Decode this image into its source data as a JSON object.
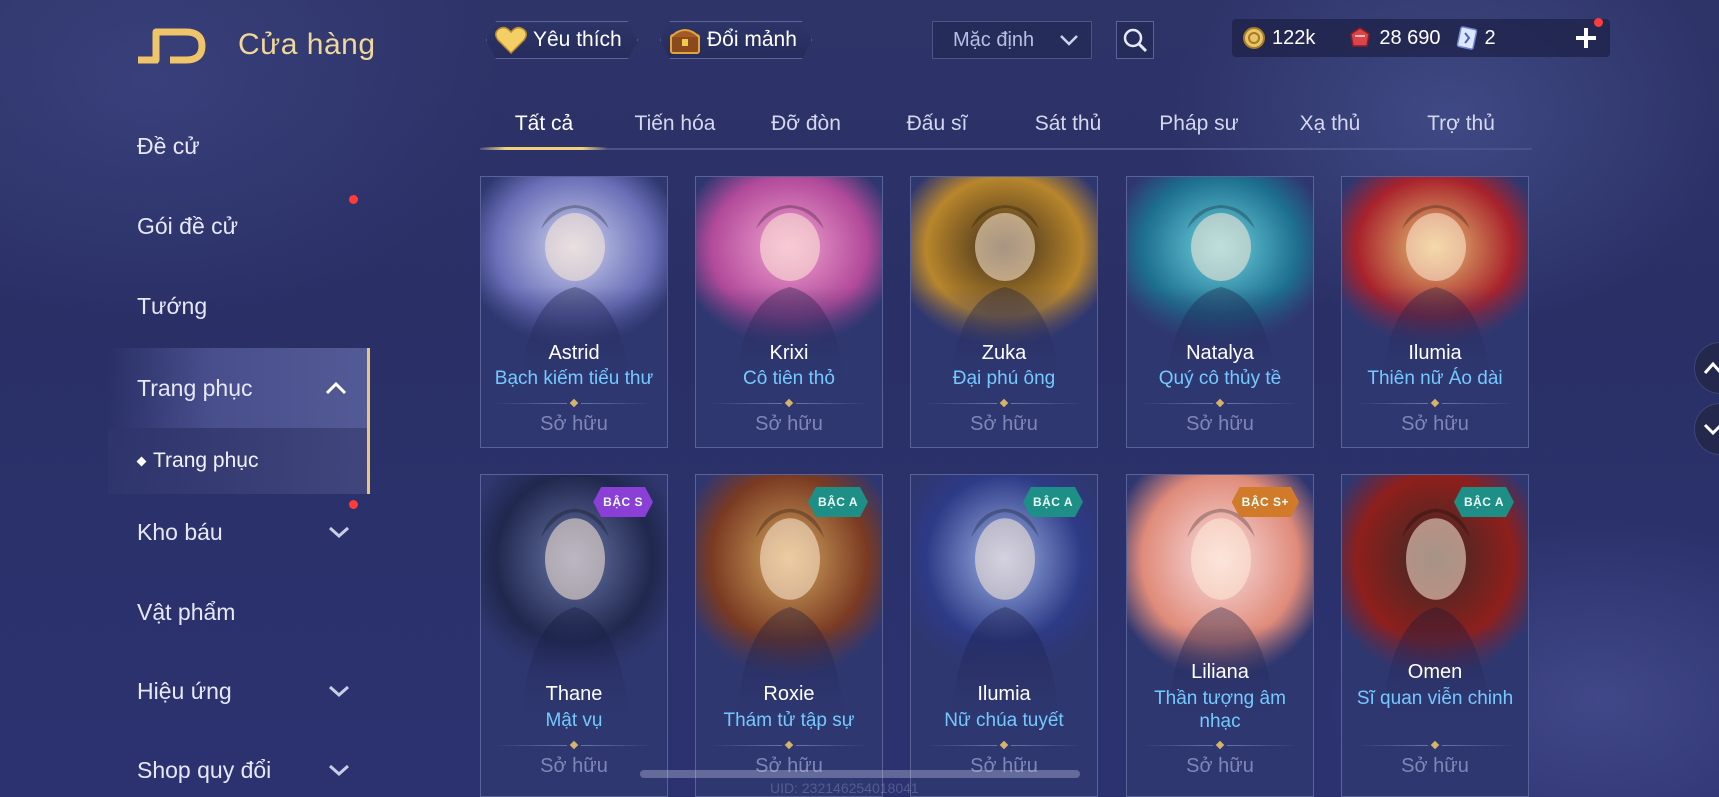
{
  "header": {
    "title": "Cửa hàng",
    "favorite_label": "Yêu thích",
    "fragment_label": "Đổi mảnh",
    "sort_selected": "Mặc định"
  },
  "currency": {
    "gold": "122k",
    "vouchers": "28 690",
    "tickets": "2"
  },
  "sidebar": {
    "items": [
      {
        "label": "Đề cử"
      },
      {
        "label": "Gói đề cử"
      },
      {
        "label": "Tướng"
      },
      {
        "label": "Trang phục"
      },
      {
        "label": "Kho báu"
      },
      {
        "label": "Vật phẩm"
      },
      {
        "label": "Hiệu ứng"
      },
      {
        "label": "Shop quy đổi"
      }
    ],
    "sub_item": "Trang phục"
  },
  "tabs": [
    {
      "label": "Tất cả"
    },
    {
      "label": "Tiến hóa"
    },
    {
      "label": "Đỡ đòn"
    },
    {
      "label": "Đấu sĩ"
    },
    {
      "label": "Sát thủ"
    },
    {
      "label": "Pháp sư"
    },
    {
      "label": "Xạ thủ"
    },
    {
      "label": "Trợ thủ"
    }
  ],
  "cards": [
    {
      "hero": "Astrid",
      "skin": "Bạch kiếm tiểu thư",
      "status": "Sở hữu",
      "colors": [
        "#6a6fb8",
        "#cfd3ee"
      ]
    },
    {
      "hero": "Krixi",
      "skin": "Cô tiên thỏ",
      "status": "Sở hữu",
      "colors": [
        "#b24a9a",
        "#f2a3d2"
      ]
    },
    {
      "hero": "Zuka",
      "skin": "Đại phú ông",
      "status": "Sở hữu",
      "colors": [
        "#b8862c",
        "#3d2c1a"
      ]
    },
    {
      "hero": "Natalya",
      "skin": "Quý cô thủy tề",
      "status": "Sở hữu",
      "colors": [
        "#1d6f8f",
        "#6fd3e0"
      ]
    },
    {
      "hero": "Ilumia",
      "skin": "Thiên nữ Áo dài",
      "status": "Sở hữu",
      "colors": [
        "#a8222c",
        "#e8c474"
      ]
    },
    {
      "hero": "Thane",
      "skin": "Mật vụ",
      "status": "Sở hữu",
      "tier": "BẬC S",
      "colors": [
        "#20284e",
        "#6a76a8"
      ]
    },
    {
      "hero": "Roxie",
      "skin": "Thám tử tập sự",
      "status": "Sở hữu",
      "tier": "BẬC A",
      "colors": [
        "#7a3a22",
        "#d4a760"
      ]
    },
    {
      "hero": "Ilumia",
      "skin": "Nữ chúa tuyết",
      "status": "Sở hữu",
      "tier": "BẬC A",
      "colors": [
        "#2d3a86",
        "#9fb4e8"
      ]
    },
    {
      "hero": "Liliana",
      "skin": "Thần tượng âm nhạc",
      "status": "Sở hữu",
      "tier": "BẬC S+",
      "colors": [
        "#e08b7a",
        "#f8dde0"
      ]
    },
    {
      "hero": "Omen",
      "skin": "Sĩ quan viễn chinh",
      "status": "Sở hữu",
      "tier": "BẬC A",
      "colors": [
        "#8e1f1c",
        "#3a2a26"
      ]
    }
  ],
  "tier_colors": {
    "BẬC S": "#8b3fd6",
    "BẬC A": "#1d8f86",
    "BẬC S+": "#d07a2a"
  },
  "footer": {
    "uid": "UID: 232146254018041"
  }
}
